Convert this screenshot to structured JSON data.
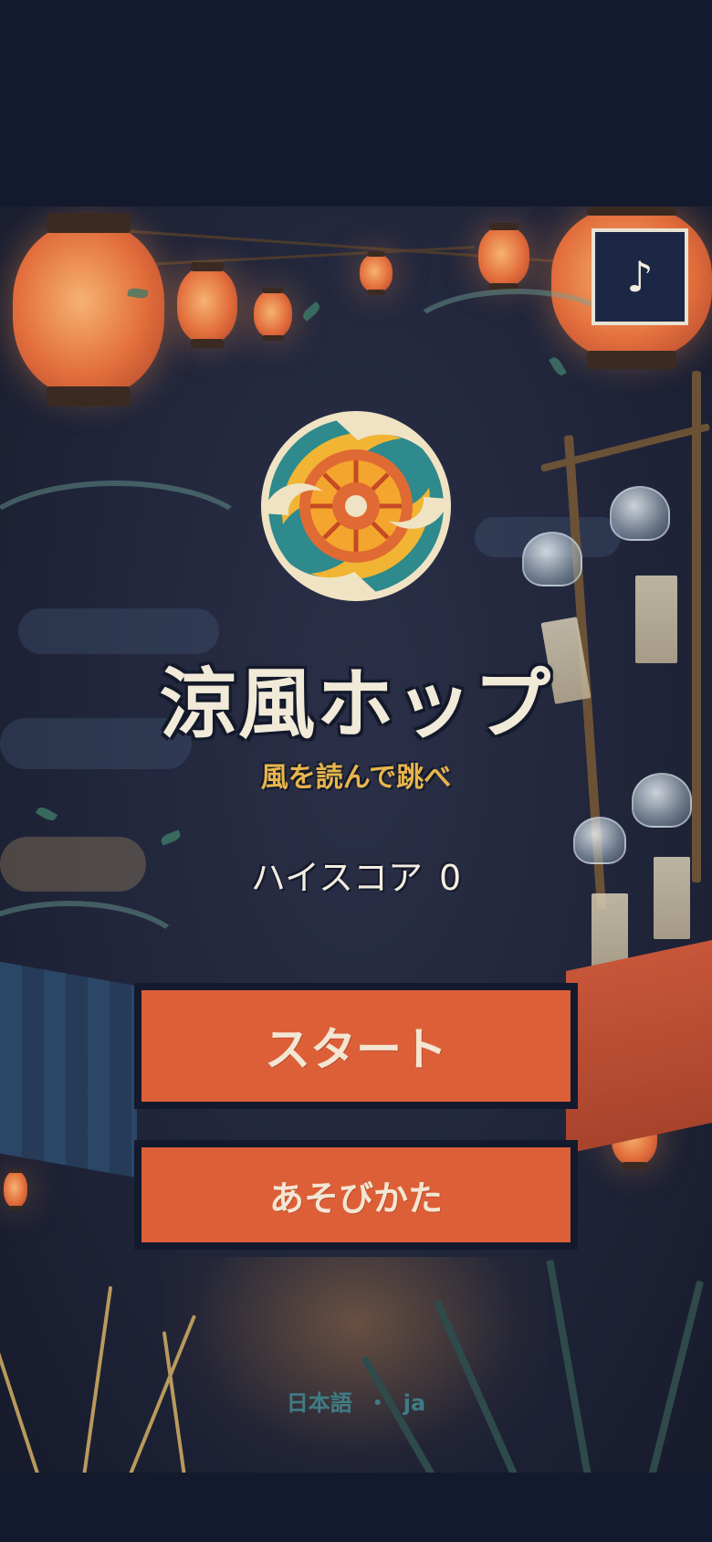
{
  "music_button": {
    "label": "♪"
  },
  "title": "涼風ホップ",
  "subtitle": "風を読んで跳べ",
  "high_score": {
    "label": "ハイスコア",
    "value": "0"
  },
  "buttons": {
    "start": "スタート",
    "how_to_play": "あそびかた"
  },
  "language": {
    "name": "日本語",
    "separator": "・",
    "code": "ja"
  },
  "colors": {
    "page_background": "#131a2e",
    "button_fill": "#dd5f38",
    "button_border": "#131a2e",
    "title_text": "#f1ead9",
    "subtitle_text": "#e7b54c",
    "language_text": "#3f7d86"
  }
}
